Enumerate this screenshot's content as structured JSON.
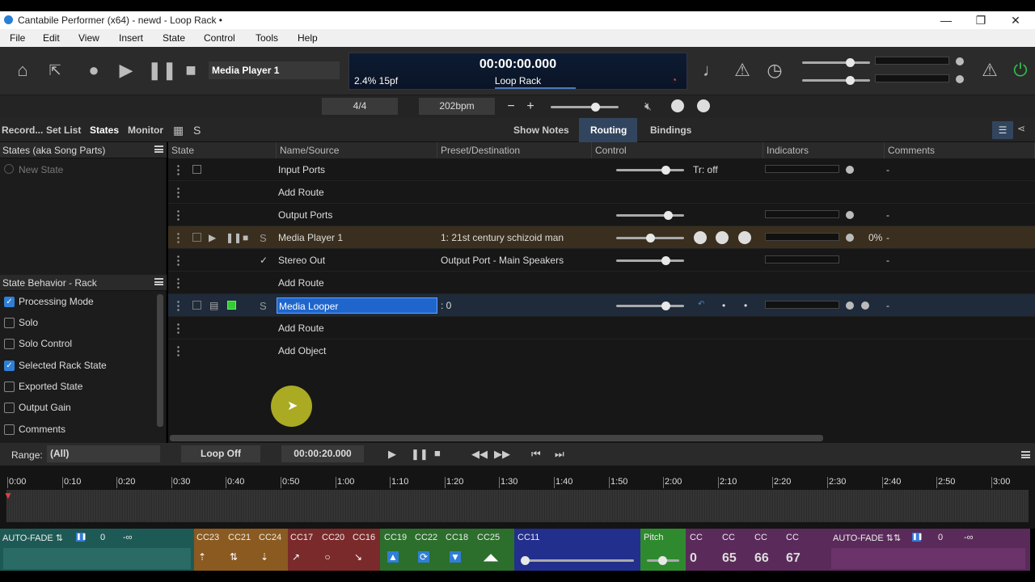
{
  "window": {
    "title": "Cantabile Performer (x64) - newd - Loop Rack •",
    "min": "—",
    "restore": "❐",
    "close": "✕"
  },
  "menu": [
    "File",
    "Edit",
    "View",
    "Insert",
    "State",
    "Control",
    "Tools",
    "Help"
  ],
  "toolbar": {
    "media_field": "Media Player 1",
    "lcd_time": "00:00:00.000",
    "lcd_cpu": "2.4%  15pf",
    "lcd_name": "Loop Rack"
  },
  "row2": {
    "time_sig": "4/4",
    "tempo": "202bpm",
    "minus": "−",
    "plus": "+"
  },
  "tabs": {
    "left": [
      "Record...",
      "Set List",
      "States",
      "Monitor"
    ],
    "active_left": "States",
    "s_label": "S",
    "show_notes": "Show Notes",
    "routing": "Routing",
    "bindings": "Bindings"
  },
  "states_pane": {
    "header": "States (aka Song Parts)",
    "new_state": "New State"
  },
  "behavior_pane": {
    "header": "State Behavior - Rack",
    "items": [
      {
        "label": "Processing Mode",
        "checked": true
      },
      {
        "label": "Solo",
        "checked": false
      },
      {
        "label": "Solo Control",
        "checked": false
      },
      {
        "label": "Selected Rack State",
        "checked": true
      },
      {
        "label": "Exported State",
        "checked": false
      },
      {
        "label": "Output Gain",
        "checked": false
      },
      {
        "label": "Comments",
        "checked": false
      }
    ]
  },
  "grid": {
    "columns": [
      "State",
      "Name/Source",
      "Preset/Destination",
      "Control",
      "Indicators",
      "Comments"
    ],
    "rows": [
      {
        "name": "Input Ports",
        "preset": "",
        "control_text": "Tr: off",
        "indicator_text": "",
        "comment": "-"
      },
      {
        "name": "Add Route",
        "preset": "",
        "control_text": "",
        "indicator_text": "",
        "comment": ""
      },
      {
        "name": "Output Ports",
        "preset": "",
        "control_text": "",
        "indicator_text": "",
        "comment": "-"
      },
      {
        "name": "Media Player 1",
        "preset": "1: 21st century schizoid man",
        "control_text": "",
        "indicator_text": "0%",
        "comment": "-"
      },
      {
        "name": "Stereo Out",
        "preset": "Output Port - Main Speakers",
        "control_text": "",
        "indicator_text": "",
        "comment": "-"
      },
      {
        "name": "Add Route",
        "preset": "",
        "control_text": "",
        "indicator_text": "",
        "comment": ""
      },
      {
        "name": "Media Looper",
        "preset": ": 0",
        "control_text": "",
        "indicator_text": "",
        "comment": "-"
      },
      {
        "name": "Add Route",
        "preset": "",
        "control_text": "",
        "indicator_text": "",
        "comment": ""
      },
      {
        "name": "Add Object",
        "preset": "",
        "control_text": "",
        "indicator_text": "",
        "comment": ""
      }
    ]
  },
  "footer": {
    "range_label": "Range:",
    "range_value": "(All)",
    "loop": "Loop Off",
    "time": "00:00:20.000"
  },
  "timeline": {
    "ticks": [
      "0:00",
      "0:10",
      "0:20",
      "0:30",
      "0:40",
      "0:50",
      "1:00",
      "1:10",
      "1:20",
      "1:30",
      "1:40",
      "1:50",
      "2:00",
      "2:10",
      "2:20",
      "2:30",
      "2:40",
      "2:50",
      "3:00"
    ]
  },
  "bottom": {
    "autofade_left": "AUTO-FADE ⇅",
    "zero_left": "0",
    "inf_left": "-∞",
    "cc": [
      "CC23",
      "CC21",
      "CC24",
      "CC17",
      "CC20",
      "CC16",
      "CC19",
      "CC22",
      "CC18",
      "CC25"
    ],
    "cc11": "CC11",
    "pitch": "Pitch",
    "cc_small": [
      "CC",
      "CC",
      "CC",
      "CC"
    ],
    "cc_vals": [
      "0",
      "65",
      "66",
      "67"
    ],
    "autofade_right": "AUTO-FADE ⇅⇅",
    "zero_right": "0",
    "inf_right": "-∞"
  },
  "colors": {
    "accent": "#2f7fd6",
    "media_row": "#3a2f1e",
    "looper_row": "#1f2b3a",
    "teal": "#1e5a55",
    "orange": "#8a5a20",
    "red": "#7a2a2a",
    "green": "#2c6e2c",
    "blue": "#232f8c",
    "purple": "#5a2a5a"
  }
}
